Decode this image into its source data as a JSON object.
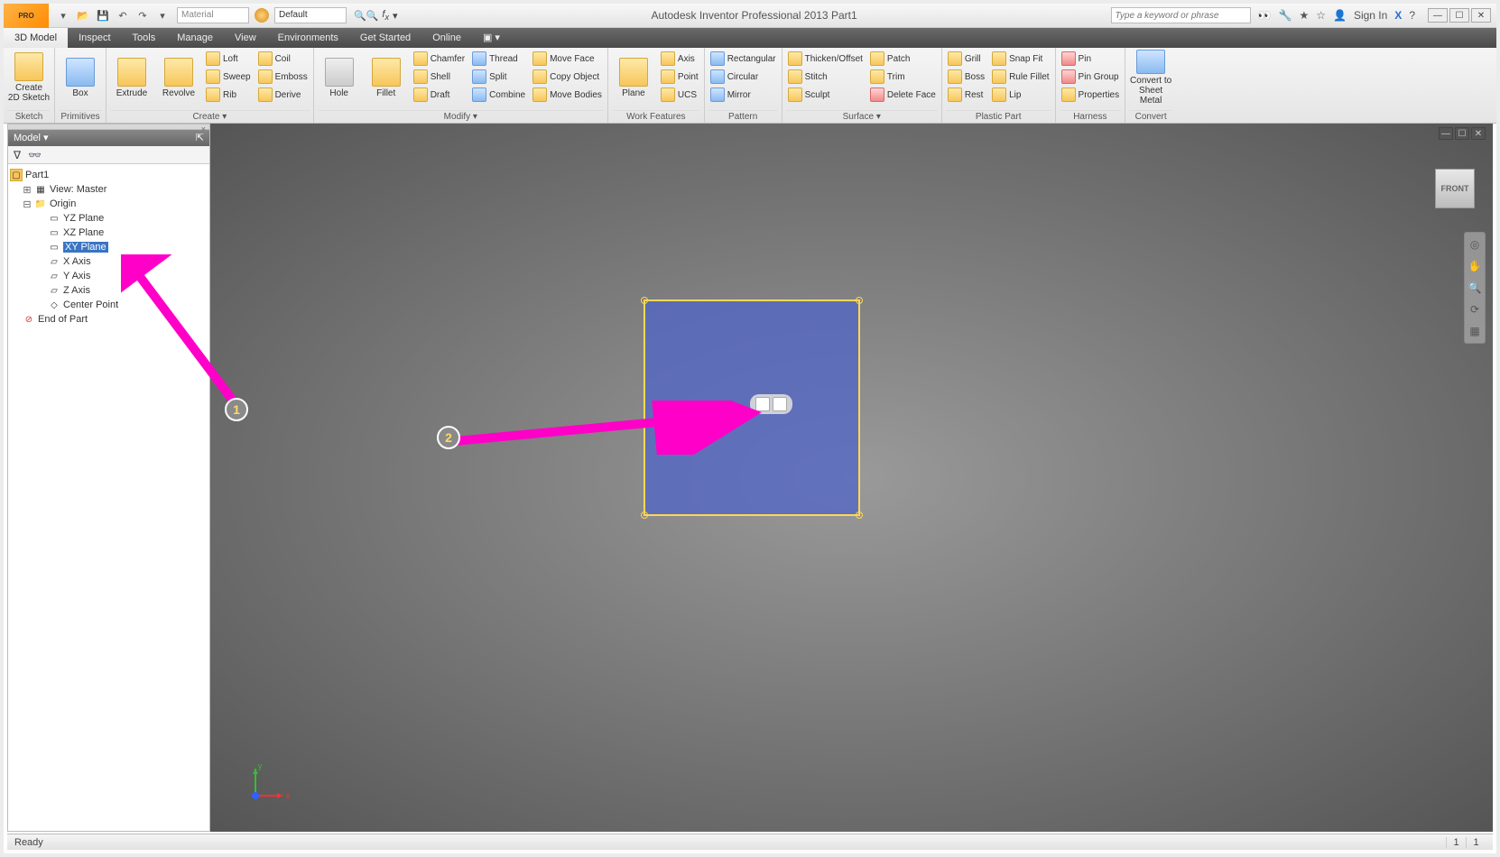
{
  "title": "Autodesk Inventor Professional 2013  Part1",
  "search_placeholder": "Type a keyword or phrase",
  "signin": "Sign In",
  "material_dd": "Material",
  "appearance_dd": "Default",
  "tabs": [
    "3D Model",
    "Inspect",
    "Tools",
    "Manage",
    "View",
    "Environments",
    "Get Started",
    "Online"
  ],
  "active_tab": 0,
  "ribbon": {
    "sketch": {
      "label": "Sketch",
      "create": "Create\n2D Sketch"
    },
    "primitives": {
      "label": "Primitives",
      "box": "Box"
    },
    "create": {
      "label": "Create ▾",
      "extrude": "Extrude",
      "revolve": "Revolve",
      "r1": [
        "Loft",
        "Coil"
      ],
      "r2": [
        "Sweep",
        "Emboss"
      ],
      "r3": [
        "Rib",
        "Derive"
      ]
    },
    "modify": {
      "label": "Modify ▾",
      "hole": "Hole",
      "fillet": "Fillet",
      "c1": [
        "Chamfer",
        "Shell",
        "Draft"
      ],
      "c2": [
        "Thread",
        "Split",
        "Combine"
      ],
      "c3": [
        "Move Face",
        "Copy Object",
        "Move Bodies"
      ]
    },
    "workfeat": {
      "label": "Work Features",
      "plane": "Plane",
      "items": [
        "Axis",
        "Point",
        "UCS"
      ]
    },
    "pattern": {
      "label": "Pattern",
      "items": [
        "Rectangular",
        "Circular",
        "Mirror"
      ]
    },
    "surface": {
      "label": "Surface ▾",
      "c1": [
        "Thicken/Offset",
        "Stitch",
        "Sculpt"
      ],
      "c2": [
        "Patch",
        "Trim",
        "Delete Face"
      ]
    },
    "plastic": {
      "label": "Plastic Part",
      "c1": [
        "Grill",
        "Boss",
        "Rest"
      ],
      "c2": [
        "Snap Fit",
        "Rule Fillet",
        "Lip"
      ]
    },
    "harness": {
      "label": "Harness",
      "items": [
        "Pin",
        "Pin Group",
        "Properties"
      ]
    },
    "convert": {
      "label": "Convert",
      "btn": "Convert to\nSheet Metal"
    }
  },
  "model_panel": {
    "title": "Model ▾"
  },
  "tree": {
    "root": "Part1",
    "view": "View: Master",
    "origin": "Origin",
    "planes": [
      "YZ Plane",
      "XZ Plane",
      "XY Plane"
    ],
    "axes": [
      "X Axis",
      "Y Axis",
      "Z Axis"
    ],
    "center": "Center Point",
    "end": "End of Part",
    "selected": "XY Plane"
  },
  "viewcube": "FRONT",
  "triad": {
    "x": "x",
    "y": "y"
  },
  "status": {
    "ready": "Ready",
    "n1": "1",
    "n2": "1"
  },
  "annotations": {
    "b1": "1",
    "b2": "2"
  }
}
